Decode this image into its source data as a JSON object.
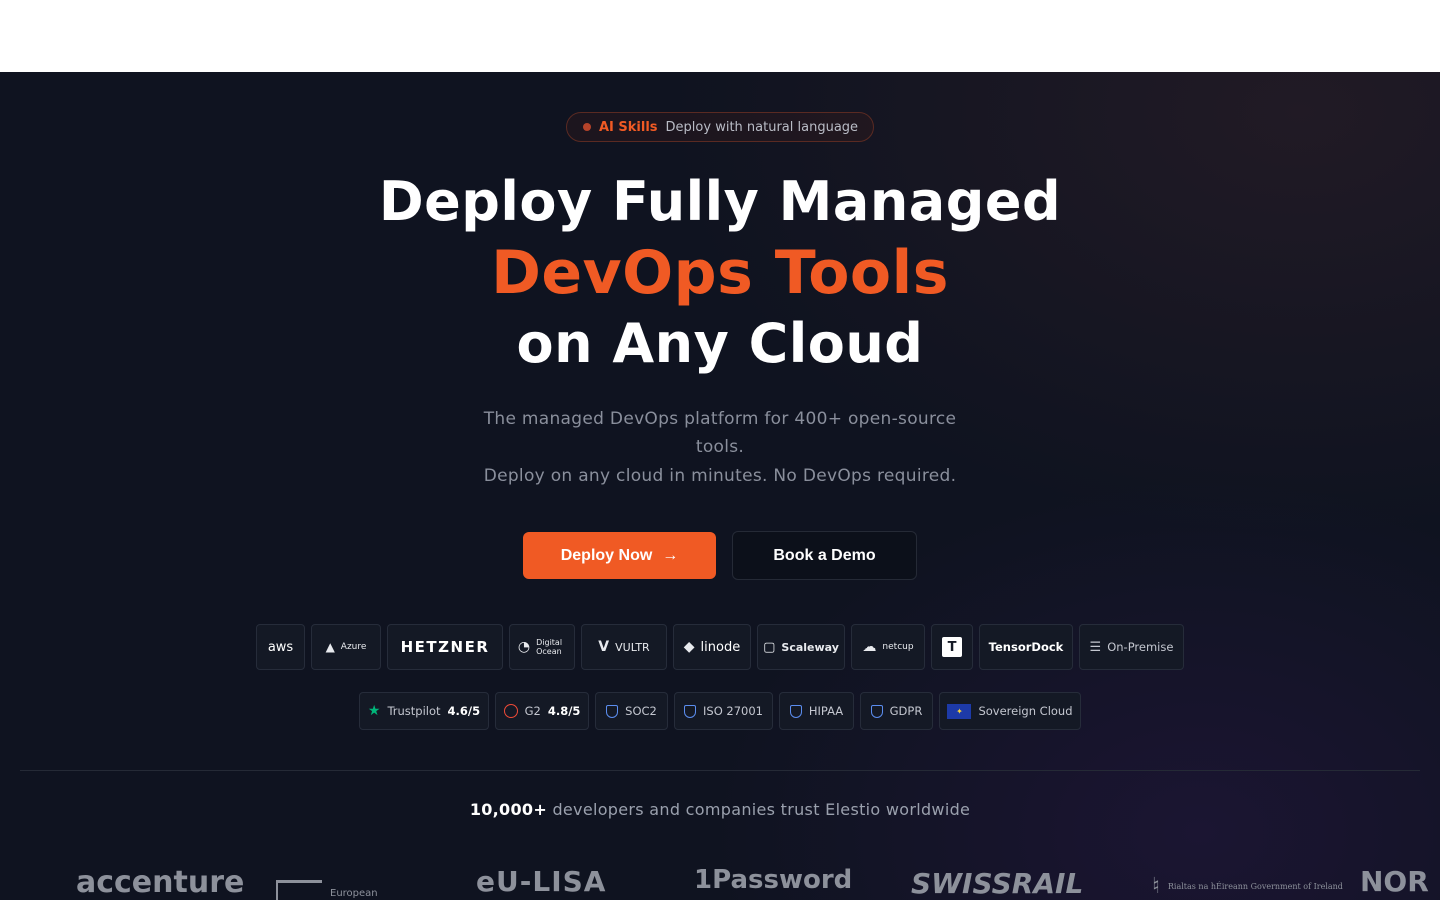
{
  "badge": {
    "tag": "AI Skills",
    "text": "Deploy with natural language"
  },
  "headline": {
    "line1": "Deploy Fully Managed",
    "line2": "DevOps Tools",
    "line3": "on Any Cloud"
  },
  "subtitle": {
    "line1": "The managed DevOps platform for 400+ open-source tools.",
    "line2": "Deploy on any cloud in minutes. No DevOps required."
  },
  "cta": {
    "primary": "Deploy Now",
    "primary_arrow": "→",
    "secondary": "Book a Demo"
  },
  "providers": [
    "aws",
    "Azure",
    "HETZNER",
    "Digital Ocean",
    "VULTR",
    "linode",
    "Scaleway",
    "netcup",
    "T",
    "TensorDock",
    "On-Premise"
  ],
  "ratings": [
    {
      "name": "Trustpilot",
      "score": "4.6/5"
    },
    {
      "name": "G2",
      "score": "4.8/5"
    }
  ],
  "compliance": [
    "SOC2",
    "ISO 27001",
    "HIPAA",
    "GDPR",
    "Sovereign Cloud"
  ],
  "trust": {
    "count": "10,000+",
    "text": " developers and companies trust Elestio worldwide"
  },
  "customers": [
    "accenture",
    "European",
    "eU-LISA",
    "1Password",
    "SWISSRAIL",
    "Rialtas na hÉireann Government of Ireland",
    "NOR"
  ],
  "colors": {
    "accent": "#f05a24",
    "background": "#0f1320"
  }
}
